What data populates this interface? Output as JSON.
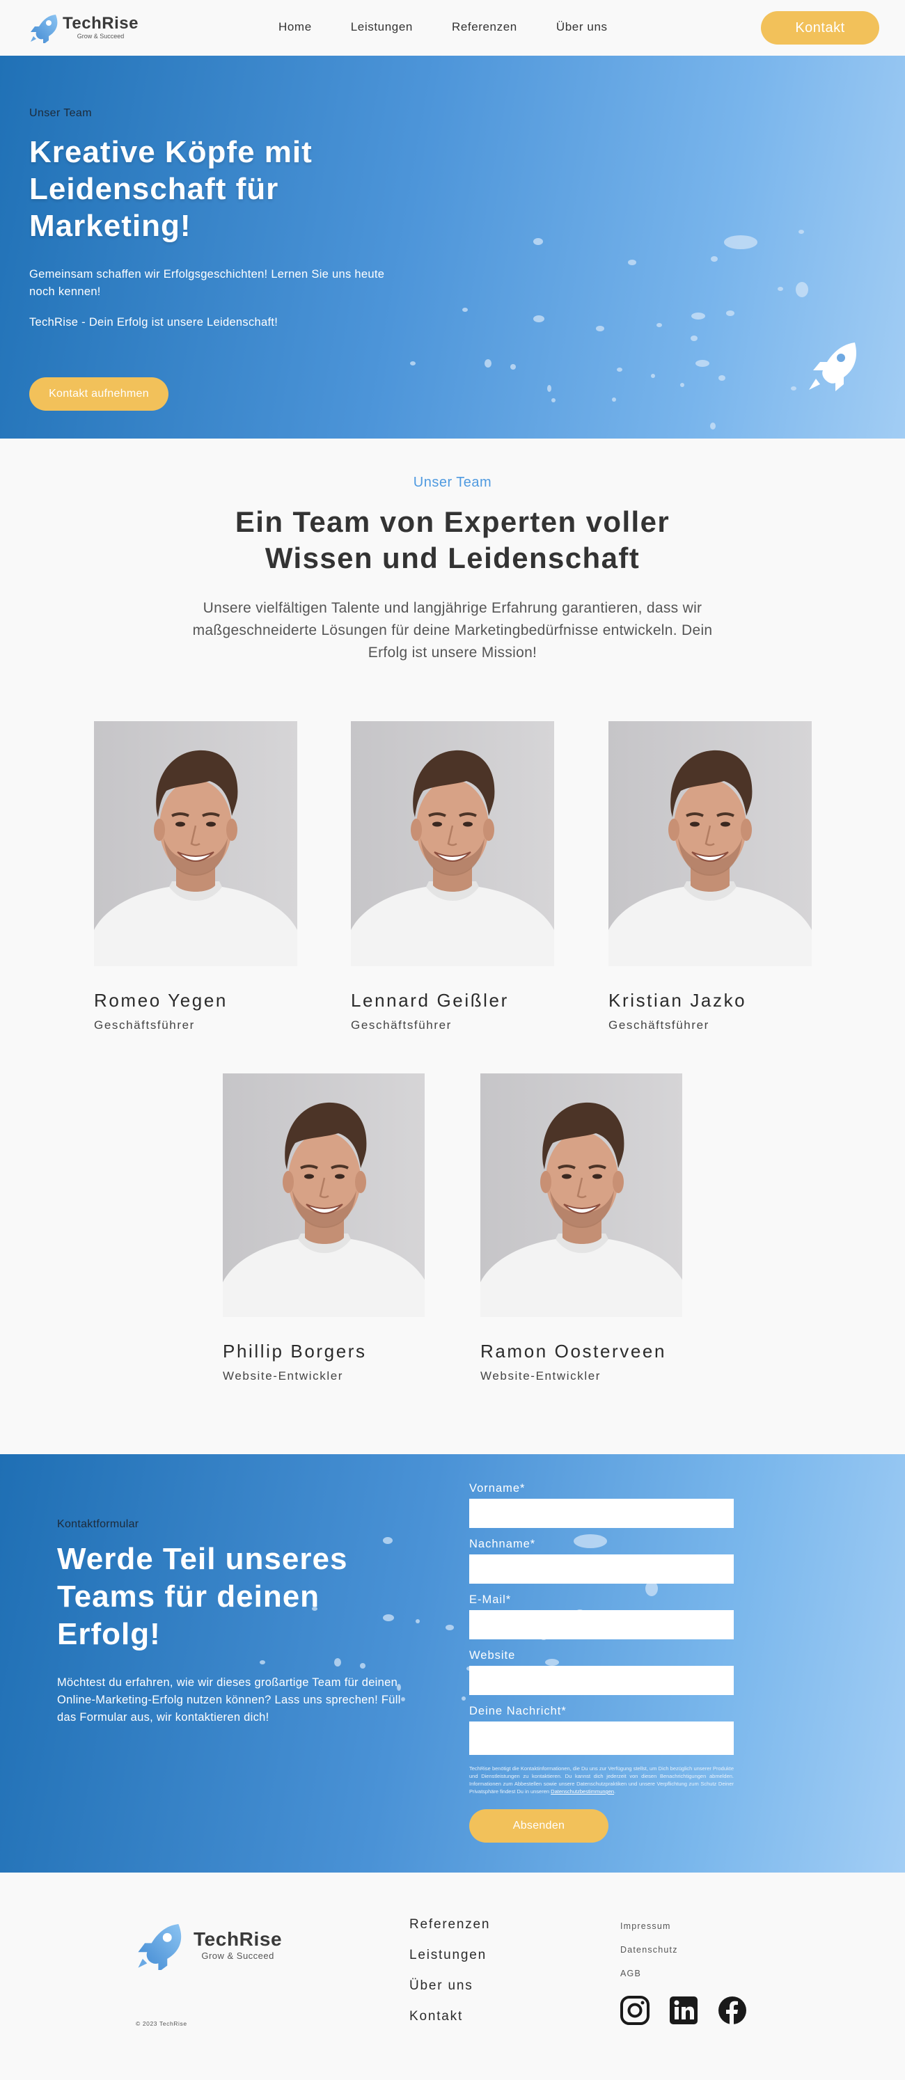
{
  "brand": {
    "name": "TechRise",
    "tagline": "Grow & Succeed",
    "accent": "#f2c15a",
    "primary": "#2071b6",
    "light": "#a2cdf4"
  },
  "header": {
    "nav": [
      "Home",
      "Leistungen",
      "Referenzen",
      "Über uns"
    ],
    "cta_label": "Kontakt"
  },
  "hero": {
    "eyebrow": "Unser Team",
    "title": "Kreative Köpfe mit Leidenschaft für Marketing!",
    "text": "Gemeinsam schaffen wir Erfolgsgeschichten! Lernen Sie uns heute noch kennen!",
    "text2": "TechRise - Dein Erfolg ist unsere Leidenschaft!",
    "cta_label": "Kontakt aufnehmen",
    "icon": "rocket-icon"
  },
  "team": {
    "eyebrow": "Unser Team",
    "title": "Ein Team von Experten voller Wissen und Leidenschaft",
    "text": "Unsere vielfältigen Talente und langjährige Erfahrung garantieren, dass wir maßgeschneiderte Lösungen für deine Marketingbedürfnisse entwickeln. Dein Erfolg ist unsere Mission!",
    "members": [
      {
        "name": "Romeo Yegen",
        "role": "Geschäftsführer"
      },
      {
        "name": "Lennard Geißler",
        "role": "Geschäftsführer"
      },
      {
        "name": "Kristian Jazko",
        "role": "Geschäftsführer"
      },
      {
        "name": "Phillip Borgers",
        "role": "Website-Entwickler"
      },
      {
        "name": "Ramon Oosterveen",
        "role": "Website-Entwickler"
      }
    ]
  },
  "contact": {
    "eyebrow": "Kontaktformular",
    "title": "Werde Teil unseres Teams für deinen Erfolg!",
    "text": "Möchtest du erfahren, wie wir dieses großartige Team für deinen Online-Marketing-Erfolg nutzen können? Lass uns sprechen! Füll das Formular aus, wir kontaktieren dich!",
    "fields": {
      "firstname": "Vorname*",
      "lastname": "Nachname*",
      "email": "E-Mail*",
      "website": "Website",
      "message": "Deine Nachricht*"
    },
    "privacy": "TechRise benötigt die Kontaktinformationen, die Du uns zur Verfügung stellst, um Dich bezüglich unserer Produkte und Dienstleistungen zu kontaktieren. Du kannst dich jederzeit von diesen Benachrichtigungen abmelden. Informationen zum Abbestellen sowie unsere Datenschutzpraktiken und unsere Verpflichtung zum Schutz Deiner Privatsphäre findest Du in unseren",
    "privacy_link": "Datenschutzbestimmungen",
    "submit_label": "Absenden"
  },
  "footer": {
    "nav": [
      "Referenzen",
      "Leistungen",
      "Über uns",
      "Kontakt"
    ],
    "legal": [
      "Impressum",
      "Datenschutz",
      "AGB"
    ],
    "copyright": "© 2023 TechRise",
    "social": [
      "instagram-icon",
      "linkedin-icon",
      "facebook-icon"
    ]
  }
}
